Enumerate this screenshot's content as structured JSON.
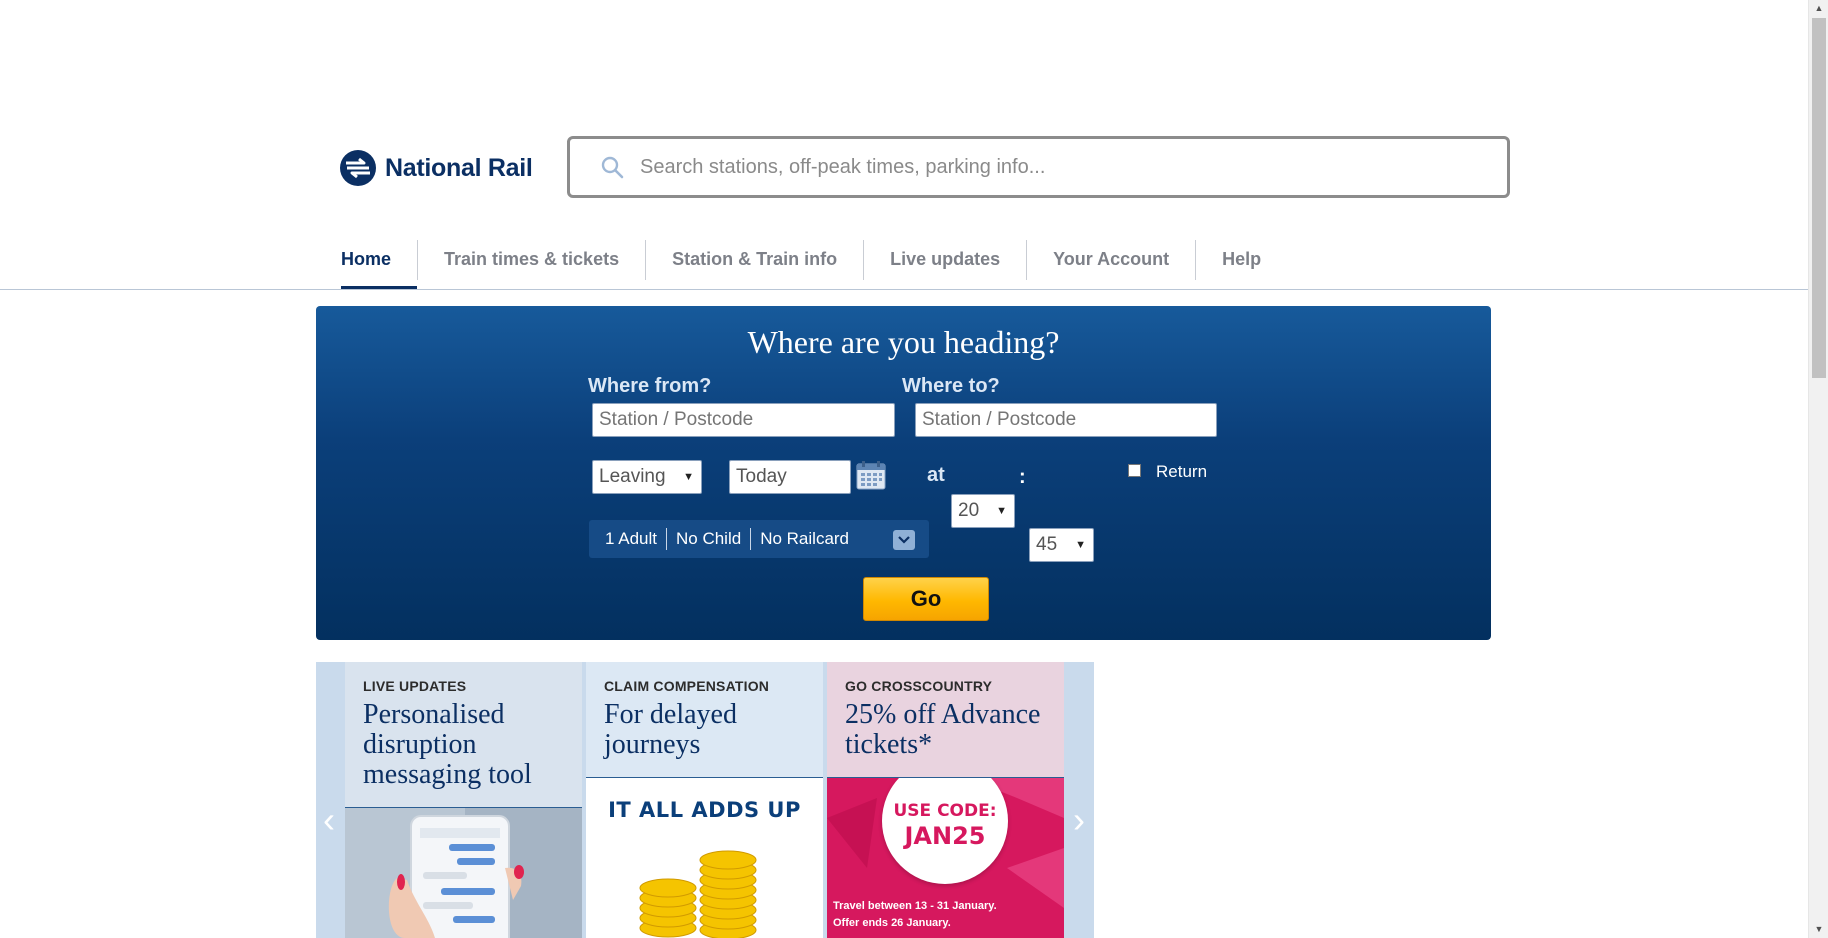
{
  "header": {
    "logo_text": "National Rail",
    "search_placeholder": "Search stations, off-peak times, parking info..."
  },
  "nav": {
    "items": [
      {
        "label": "Home",
        "active": true
      },
      {
        "label": "Train times & tickets"
      },
      {
        "label": "Station & Train info"
      },
      {
        "label": "Live updates"
      },
      {
        "label": "Your Account"
      },
      {
        "label": "Help"
      }
    ]
  },
  "planner": {
    "title": "Where are you heading?",
    "from_label": "Where from?",
    "from_placeholder": "Station / Postcode",
    "to_label": "Where to?",
    "to_placeholder": "Station / Postcode",
    "leaving_value": "Leaving",
    "date_value": "Today",
    "at_label": "at",
    "hour_value": "20",
    "minute_value": "45",
    "time_separator": ":",
    "return_label": "Return",
    "return_checked": false,
    "passengers": {
      "adults": "1 Adult",
      "children": "No Child",
      "railcard": "No Railcard"
    },
    "go_label": "Go"
  },
  "carousel": {
    "cards": [
      {
        "kicker": "LIVE UPDATES",
        "title": "Personalised disruption messaging tool",
        "bg_color": "#d9e3ee"
      },
      {
        "kicker": "CLAIM COMPENSATION",
        "title": "For delayed journeys",
        "image_text": "IT ALL ADDS UP",
        "bg_color": "#dce8f4"
      },
      {
        "kicker": "GO CROSSCOUNTRY",
        "title": "25% off Advance tickets*",
        "code_line1": "USE CODE:",
        "code_line2": "JAN25",
        "footnote_line1": "Travel between 13 - 31 January.",
        "footnote_line2": "Offer ends 26 January.",
        "bg_color": "#e9d3df"
      }
    ]
  },
  "colors": {
    "brand_navy": "#0b2f63",
    "planner_top": "#175a9b",
    "planner_bottom": "#03305f",
    "go_button": "#ffb800",
    "promo_pink": "#d6185e"
  }
}
